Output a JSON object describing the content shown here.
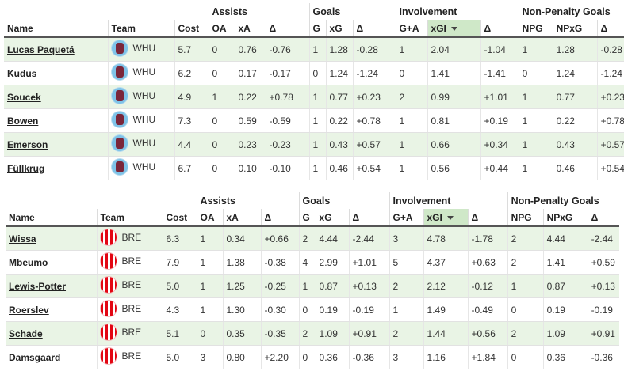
{
  "headers": {
    "groups": {
      "assists": "Assists",
      "goals": "Goals",
      "involvement": "Involvement",
      "npg": "Non-Penalty Goals"
    },
    "columns": [
      "Name",
      "Team",
      "Cost",
      "OA",
      "xA",
      "Δ",
      "G",
      "xG",
      "Δ",
      "G+A",
      "xGI",
      "Δ",
      "NPG",
      "NPxG",
      "Δ"
    ]
  },
  "icons": {
    "sort": "sort-desc-icon",
    "whu": "west-ham-crest-icon",
    "bre": "brentford-crest-icon"
  },
  "colors": {
    "highlight_row": "#e9f4e5",
    "sorted_header": "#cfe8c8",
    "whu_claret": "#7a263a",
    "whu_blue": "#7fc3e8",
    "bre_red": "#e30613"
  },
  "table1": {
    "rows": [
      {
        "name": "Lucas Paquetá",
        "team": "WHU",
        "cost": "5.7",
        "oa": "0",
        "xa": "0.76",
        "da": "-0.76",
        "g": "1",
        "xg": "1.28",
        "dg": "-0.28",
        "ga": "1",
        "xgi": "2.04",
        "di": "-1.04",
        "npg": "1",
        "npxg": "1.28",
        "dn": "-0.28"
      },
      {
        "name": "Kudus",
        "team": "WHU",
        "cost": "6.2",
        "oa": "0",
        "xa": "0.17",
        "da": "-0.17",
        "g": "0",
        "xg": "1.24",
        "dg": "-1.24",
        "ga": "0",
        "xgi": "1.41",
        "di": "-1.41",
        "npg": "0",
        "npxg": "1.24",
        "dn": "-1.24"
      },
      {
        "name": "Soucek",
        "team": "WHU",
        "cost": "4.9",
        "oa": "1",
        "xa": "0.22",
        "da": "+0.78",
        "g": "1",
        "xg": "0.77",
        "dg": "+0.23",
        "ga": "2",
        "xgi": "0.99",
        "di": "+1.01",
        "npg": "1",
        "npxg": "0.77",
        "dn": "+0.23"
      },
      {
        "name": "Bowen",
        "team": "WHU",
        "cost": "7.3",
        "oa": "0",
        "xa": "0.59",
        "da": "-0.59",
        "g": "1",
        "xg": "0.22",
        "dg": "+0.78",
        "ga": "1",
        "xgi": "0.81",
        "di": "+0.19",
        "npg": "1",
        "npxg": "0.22",
        "dn": "+0.78"
      },
      {
        "name": "Emerson",
        "team": "WHU",
        "cost": "4.4",
        "oa": "0",
        "xa": "0.23",
        "da": "-0.23",
        "g": "1",
        "xg": "0.43",
        "dg": "+0.57",
        "ga": "1",
        "xgi": "0.66",
        "di": "+0.34",
        "npg": "1",
        "npxg": "0.43",
        "dn": "+0.57"
      },
      {
        "name": "Füllkrug",
        "team": "WHU",
        "cost": "6.7",
        "oa": "0",
        "xa": "0.10",
        "da": "-0.10",
        "g": "1",
        "xg": "0.46",
        "dg": "+0.54",
        "ga": "1",
        "xgi": "0.56",
        "di": "+0.44",
        "npg": "1",
        "npxg": "0.46",
        "dn": "+0.54"
      }
    ]
  },
  "table2": {
    "rows": [
      {
        "name": "Wissa",
        "team": "BRE",
        "cost": "6.3",
        "oa": "1",
        "xa": "0.34",
        "da": "+0.66",
        "g": "2",
        "xg": "4.44",
        "dg": "-2.44",
        "ga": "3",
        "xgi": "4.78",
        "di": "-1.78",
        "npg": "2",
        "npxg": "4.44",
        "dn": "-2.44"
      },
      {
        "name": "Mbeumo",
        "team": "BRE",
        "cost": "7.9",
        "oa": "1",
        "xa": "1.38",
        "da": "-0.38",
        "g": "4",
        "xg": "2.99",
        "dg": "+1.01",
        "ga": "5",
        "xgi": "4.37",
        "di": "+0.63",
        "npg": "2",
        "npxg": "1.41",
        "dn": "+0.59"
      },
      {
        "name": "Lewis-Potter",
        "team": "BRE",
        "cost": "5.0",
        "oa": "1",
        "xa": "1.25",
        "da": "-0.25",
        "g": "1",
        "xg": "0.87",
        "dg": "+0.13",
        "ga": "2",
        "xgi": "2.12",
        "di": "-0.12",
        "npg": "1",
        "npxg": "0.87",
        "dn": "+0.13"
      },
      {
        "name": "Roerslev",
        "team": "BRE",
        "cost": "4.3",
        "oa": "1",
        "xa": "1.30",
        "da": "-0.30",
        "g": "0",
        "xg": "0.19",
        "dg": "-0.19",
        "ga": "1",
        "xgi": "1.49",
        "di": "-0.49",
        "npg": "0",
        "npxg": "0.19",
        "dn": "-0.19"
      },
      {
        "name": "Schade",
        "team": "BRE",
        "cost": "5.1",
        "oa": "0",
        "xa": "0.35",
        "da": "-0.35",
        "g": "2",
        "xg": "1.09",
        "dg": "+0.91",
        "ga": "2",
        "xgi": "1.44",
        "di": "+0.56",
        "npg": "2",
        "npxg": "1.09",
        "dn": "+0.91"
      },
      {
        "name": "Damsgaard",
        "team": "BRE",
        "cost": "5.0",
        "oa": "3",
        "xa": "0.80",
        "da": "+2.20",
        "g": "0",
        "xg": "0.36",
        "dg": "-0.36",
        "ga": "3",
        "xgi": "1.16",
        "di": "+1.84",
        "npg": "0",
        "npxg": "0.36",
        "dn": "-0.36"
      }
    ]
  }
}
